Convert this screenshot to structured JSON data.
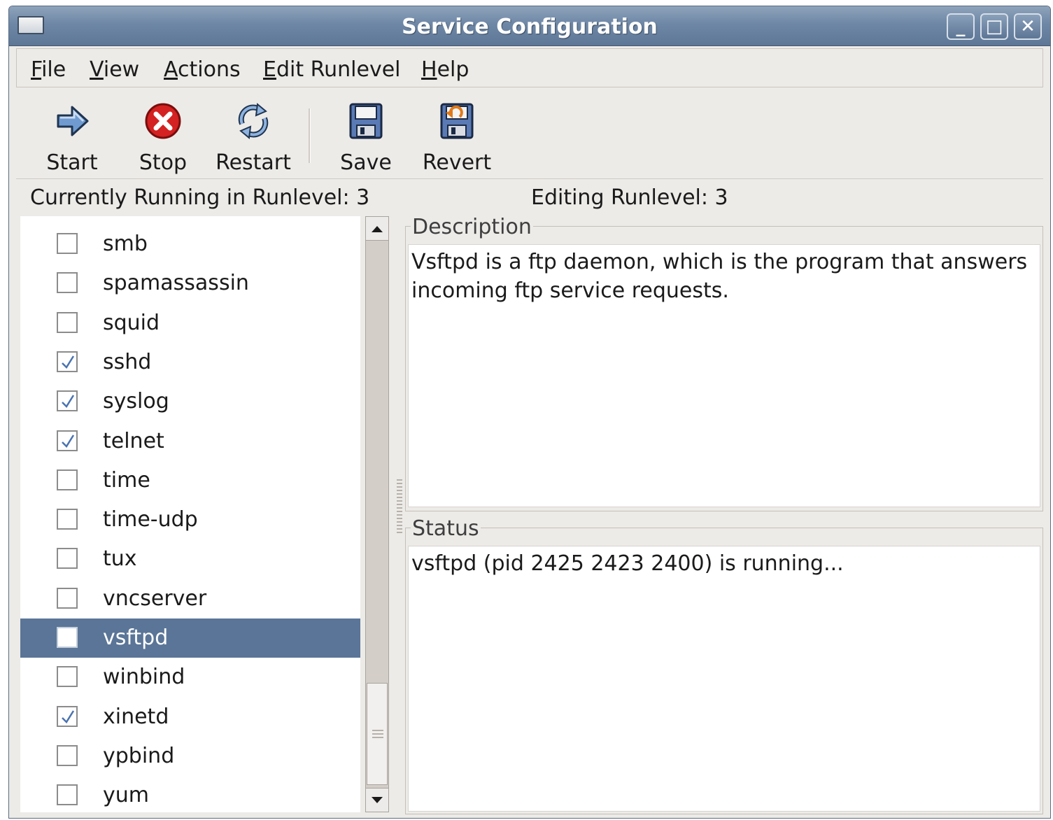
{
  "window": {
    "title": "Service Configuration",
    "controls": {
      "minimize": "_",
      "maximize": "□",
      "close": "✕"
    }
  },
  "menubar": {
    "items": [
      {
        "mnemonic": "F",
        "rest": "ile"
      },
      {
        "mnemonic": "V",
        "rest": "iew"
      },
      {
        "mnemonic": "A",
        "rest": "ctions"
      },
      {
        "mnemonic": "E",
        "rest": "dit Runlevel"
      },
      {
        "mnemonic": "H",
        "rest": "elp"
      }
    ]
  },
  "toolbar": {
    "start_label": "Start",
    "stop_label": "Stop",
    "restart_label": "Restart",
    "save_label": "Save",
    "revert_label": "Revert"
  },
  "runlevel": {
    "current": "Currently Running in Runlevel: 3",
    "editing": "Editing Runlevel: 3"
  },
  "services": [
    {
      "name": "smb",
      "checked": false
    },
    {
      "name": "spamassassin",
      "checked": false
    },
    {
      "name": "squid",
      "checked": false
    },
    {
      "name": "sshd",
      "checked": true
    },
    {
      "name": "syslog",
      "checked": true
    },
    {
      "name": "telnet",
      "checked": true
    },
    {
      "name": "time",
      "checked": false
    },
    {
      "name": "time-udp",
      "checked": false
    },
    {
      "name": "tux",
      "checked": false
    },
    {
      "name": "vncserver",
      "checked": false
    },
    {
      "name": "vsftpd",
      "checked": true,
      "selected": true
    },
    {
      "name": "winbind",
      "checked": false
    },
    {
      "name": "xinetd",
      "checked": true
    },
    {
      "name": "ypbind",
      "checked": false
    },
    {
      "name": "yum",
      "checked": false
    }
  ],
  "description": {
    "label": "Description",
    "text": "Vsftpd is a ftp daemon, which is the program that answers incoming ftp service requests."
  },
  "status": {
    "label": "Status",
    "text": "vsftpd (pid 2425 2423 2400) is running..."
  },
  "colors": {
    "titlebar": "#6e87a6",
    "selection": "#5a7597",
    "window_bg": "#edebe8",
    "stop_icon": "#d42121"
  }
}
